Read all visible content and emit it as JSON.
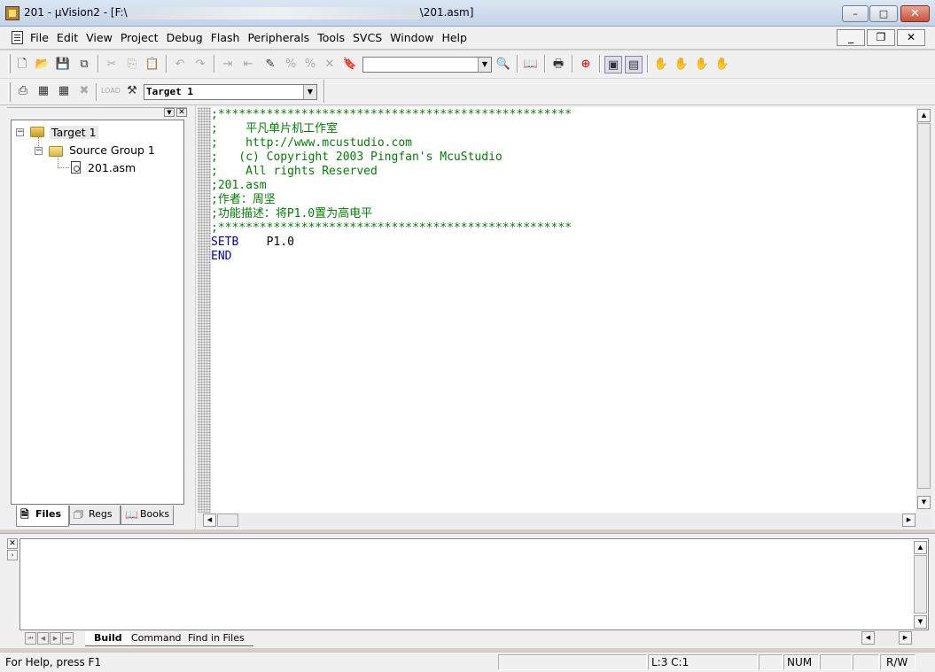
{
  "window": {
    "title_prefix": "201  - µVision2 - [F:\\",
    "title_suffix": "\\201.asm]",
    "min_glyph": "–",
    "max_glyph": "□",
    "close_glyph": "✕"
  },
  "menu": {
    "items": [
      "File",
      "Edit",
      "View",
      "Project",
      "Debug",
      "Flash",
      "Peripherals",
      "Tools",
      "SVCS",
      "Window",
      "Help"
    ],
    "mdi_min": "_",
    "mdi_restore": "❐",
    "mdi_close": "✕"
  },
  "toolbar1": {
    "find_combo_value": "",
    "buttons": [
      "new-file-icon",
      "open-icon",
      "save-icon",
      "save-all-icon",
      "cut-icon",
      "copy-icon",
      "paste-icon",
      "undo-icon",
      "redo-icon",
      "indent-icon",
      "unindent-icon",
      "bookmark-toggle-icon",
      "bookmark-next-icon",
      "bookmark-prev-icon",
      "bookmark-clear-icon",
      "find-in-files-icon",
      "find-icon",
      "browse-icon",
      "print-icon",
      "debug-session-icon",
      "window-icon",
      "output-icon",
      "breakpoint-icon",
      "breakpoint-enable-icon",
      "breakpoint-disable-icon",
      "breakpoint-kill-icon"
    ]
  },
  "toolbar2": {
    "target_combo_value": "Target 1"
  },
  "project": {
    "target": "Target 1",
    "group": "Source Group 1",
    "file": "201.asm",
    "tabs": [
      "Files",
      "Regs",
      "Books"
    ]
  },
  "editor": {
    "lines": [
      ";***************************************************",
      ";    平凡单片机工作室",
      ";    http://www.mcustudio.com",
      ";   (c) Copyright 2003 Pingfan's McuStudio",
      ";    All rights Reserved",
      ";201.asm",
      ";作者：周坚",
      ";功能描述：将P1.0置为高电平",
      ";***************************************************"
    ],
    "code": [
      {
        "kw": "SETB",
        "arg": "    P1.0"
      },
      {
        "kw": "END",
        "arg": ""
      }
    ]
  },
  "output": {
    "tabs": [
      "Build",
      "Command",
      "Find in Files"
    ]
  },
  "status": {
    "help": "For Help, press F1",
    "position": "L:3 C:1",
    "num": "NUM",
    "rw": "R/W"
  },
  "colors": {
    "comment": "#008000",
    "keyword": "#0000c0"
  }
}
